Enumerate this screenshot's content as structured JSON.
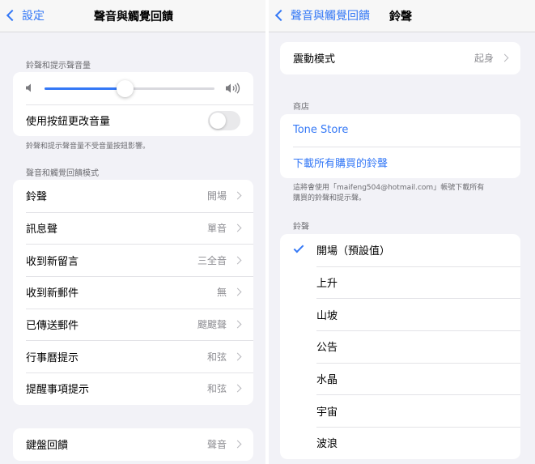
{
  "left": {
    "nav": {
      "back_label": "設定",
      "title": "聲音與觸覺回饋"
    },
    "volume_section": {
      "header": "鈴聲和提示聲音量",
      "volume_level": 0.47,
      "change_with_buttons_label": "使用按鈕更改音量",
      "change_with_buttons_on": false,
      "footer": "鈴聲和提示聲音量不受音量按鈕影響。"
    },
    "patterns_section": {
      "header": "聲音和觸覺回饋模式",
      "items": [
        {
          "label": "鈴聲",
          "value": "開場"
        },
        {
          "label": "訊息聲",
          "value": "單音"
        },
        {
          "label": "收到新留言",
          "value": "三全音"
        },
        {
          "label": "收到新郵件",
          "value": "無"
        },
        {
          "label": "已傳送郵件",
          "value": "颼颼聲"
        },
        {
          "label": "行事曆提示",
          "value": "和弦"
        },
        {
          "label": "提醒事項提示",
          "value": "和弦"
        }
      ]
    },
    "keyboard_section": {
      "items": [
        {
          "label": "鍵盤回饋",
          "value": "聲音"
        }
      ]
    }
  },
  "right": {
    "nav": {
      "back_label": "聲音與觸覺回饋",
      "title": "鈴聲"
    },
    "vibration": {
      "label": "震動模式",
      "value": "起身"
    },
    "store_section": {
      "header": "商店",
      "items": [
        {
          "label": "Tone Store"
        },
        {
          "label": "下載所有購買的鈴聲"
        }
      ],
      "footer_line1": "這將會使用「maifeng504@hotmail.com」帳號下載所有",
      "footer_line2": "購買的鈴聲和提示聲。"
    },
    "ringtones_section": {
      "header": "鈴聲",
      "items": [
        {
          "label": "開場（預設值）",
          "selected": true
        },
        {
          "label": "上升",
          "selected": false
        },
        {
          "label": "山坡",
          "selected": false
        },
        {
          "label": "公告",
          "selected": false
        },
        {
          "label": "水晶",
          "selected": false
        },
        {
          "label": "宇宙",
          "selected": false
        },
        {
          "label": "波浪",
          "selected": false
        }
      ]
    }
  },
  "colors": {
    "accent": "#3478f6",
    "background": "#f2f2f7",
    "secondary_text": "#8e8e93"
  }
}
